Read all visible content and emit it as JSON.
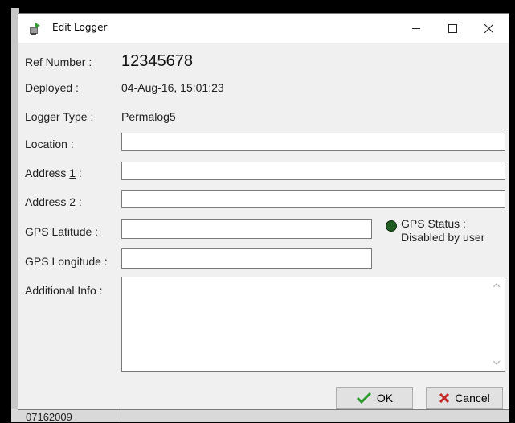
{
  "window": {
    "title": "Edit Logger"
  },
  "fields": {
    "ref_number_label": "Ref Number :",
    "ref_number_value": "12345678",
    "deployed_label": "Deployed :",
    "deployed_value": "04-Aug-16, 15:01:23",
    "logger_type_label": "Logger Type :",
    "logger_type_value": "Permalog5",
    "location_label": "Location :",
    "location_value": "",
    "address1_label_pre": "Address ",
    "address1_label_key": "1",
    "address1_label_post": " :",
    "address1_value": "",
    "address2_label_pre": "Address ",
    "address2_label_key": "2",
    "address2_label_post": " :",
    "address2_value": "",
    "gps_lat_label": "GPS Latitude :",
    "gps_lat_value": "",
    "gps_lon_label": "GPS Longitude :",
    "gps_lon_value": "",
    "additional_info_label": "Additional Info :",
    "additional_info_value": ""
  },
  "gps_status": {
    "label": "GPS Status :",
    "value": "Disabled by user",
    "indicator_color": "#1f5a1f"
  },
  "buttons": {
    "ok": "OK",
    "cancel": "Cancel"
  },
  "background": {
    "bottom_text": "07162009"
  },
  "colors": {
    "dialog_bg": "#f0f0f0",
    "button_bg": "#e1e1e1",
    "ok_check": "#2e9b2e",
    "cancel_x": "#c62828"
  }
}
